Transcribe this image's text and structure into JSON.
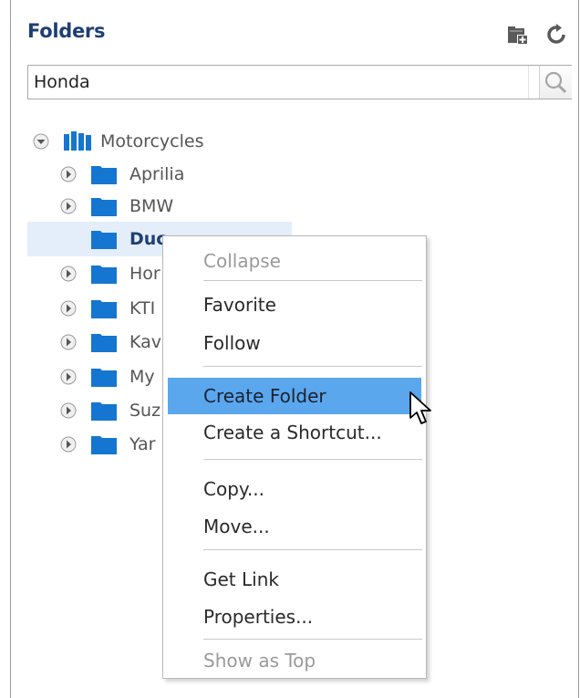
{
  "header": {
    "title": "Folders",
    "new_folder_icon": "new-folder-icon",
    "refresh_icon": "refresh-icon"
  },
  "search": {
    "value": "Honda",
    "placeholder": ""
  },
  "tree": {
    "root": {
      "label": "Motorcycles",
      "expanded": true
    },
    "items": [
      {
        "label": "Aprilia"
      },
      {
        "label": "BMW"
      },
      {
        "label": "Ducati",
        "visible": "Duc",
        "selected": true
      },
      {
        "label": "Hor"
      },
      {
        "label": "KTI"
      },
      {
        "label": "Kav"
      },
      {
        "label": "My"
      },
      {
        "label": "Suz"
      },
      {
        "label": "Yar"
      }
    ]
  },
  "context_menu": {
    "items": [
      {
        "label": "Collapse",
        "disabled": true
      },
      {
        "label": "Favorite"
      },
      {
        "label": "Follow"
      },
      {
        "label": "Create Folder",
        "highlighted": true
      },
      {
        "label": "Create a Shortcut..."
      },
      {
        "label": "Copy..."
      },
      {
        "label": "Move..."
      },
      {
        "label": "Get Link"
      },
      {
        "label": "Properties..."
      },
      {
        "label": "Show as Top",
        "disabled": true
      }
    ]
  },
  "colors": {
    "accent": "#1f3f73",
    "folder": "#1576d1",
    "selection": "#e4eefa",
    "menu_highlight": "#5aa7ee"
  }
}
